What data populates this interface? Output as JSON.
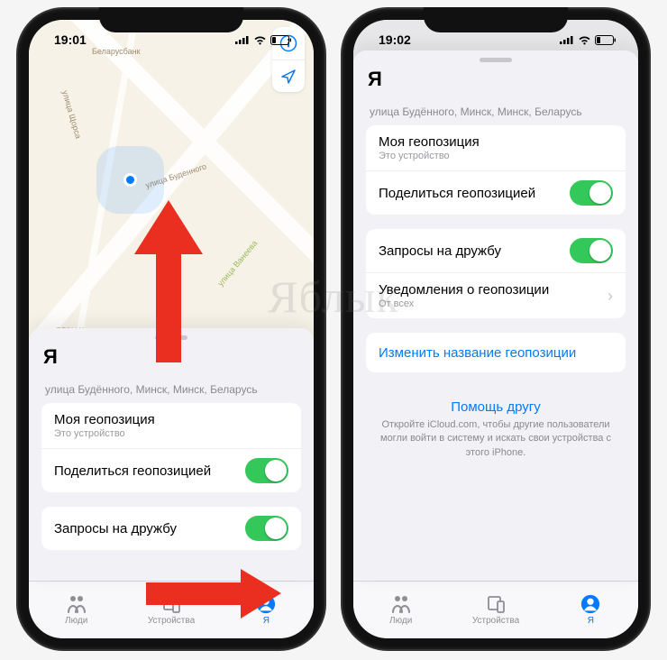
{
  "watermark": "Яблык",
  "left": {
    "status_time": "19:01",
    "map": {
      "poi1": "Беларусбанк",
      "street1": "улица Буденного",
      "street2": "улица Ванеева",
      "street3": "улица Щорса",
      "poi2": "БГЭУ Корпус"
    },
    "sheet": {
      "title": "Я",
      "address": "улица Будённого, Минск, Минск, Беларусь",
      "rows": {
        "mylocation": {
          "label": "Моя геопозиция",
          "sub": "Это устройство"
        },
        "share": {
          "label": "Поделиться геопозицией"
        },
        "requests": {
          "label": "Запросы на дружбу"
        }
      }
    },
    "tabs": {
      "people": "Люди",
      "devices": "Устройства",
      "me": "Я"
    }
  },
  "right": {
    "status_time": "19:02",
    "sheet": {
      "title": "Я",
      "address": "улица Будённого, Минск, Минск, Беларусь",
      "rows": {
        "mylocation": {
          "label": "Моя геопозиция",
          "sub": "Это устройство"
        },
        "share": {
          "label": "Поделиться геопозицией"
        },
        "requests": {
          "label": "Запросы на дружбу"
        },
        "notifications": {
          "label": "Уведомления о геопозиции",
          "sub": "От всех"
        },
        "rename": {
          "label": "Изменить название геопозиции"
        }
      },
      "help": {
        "title": "Помощь другу",
        "text": "Откройте iCloud.com, чтобы другие пользователи могли войти в систему и искать свои устройства с этого iPhone."
      }
    },
    "tabs": {
      "people": "Люди",
      "devices": "Устройства",
      "me": "Я"
    }
  }
}
